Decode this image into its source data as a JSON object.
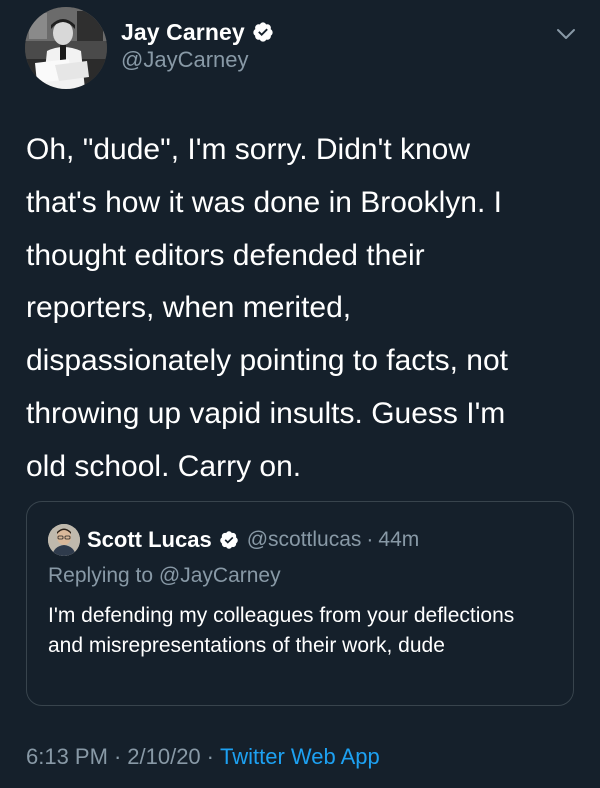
{
  "tweet": {
    "author": {
      "name": "Jay Carney",
      "handle": "@JayCarney",
      "verified": true
    },
    "text": "Oh, \"dude\", I'm sorry. Didn't know\nthat's how it was done in Brooklyn. I\nthought editors defended their\nreporters, when merited,\ndispassionately pointing to facts, not\nthrowing up vapid insults. Guess I'm\nold school. Carry on.",
    "quoted": {
      "name": "Scott Lucas",
      "handle": "@scottlucas",
      "separator": "·",
      "time": "44m",
      "replying_prefix": "Replying to ",
      "replying_to": "@JayCarney",
      "text": "I'm defending my colleagues from your deflections and misrepresentations of their work, dude"
    },
    "footer": {
      "time": "6:13 PM",
      "sep1": "·",
      "date": "2/10/20",
      "sep2": "·",
      "source": "Twitter Web App"
    }
  },
  "colors": {
    "background": "#15202b",
    "secondary_text": "#8899a6",
    "link": "#1da1f2",
    "verified_badge": "#ffffff",
    "card_border": "#38444d"
  },
  "icons": {
    "verified": "verified-badge-icon",
    "caret": "chevron-down-icon"
  }
}
